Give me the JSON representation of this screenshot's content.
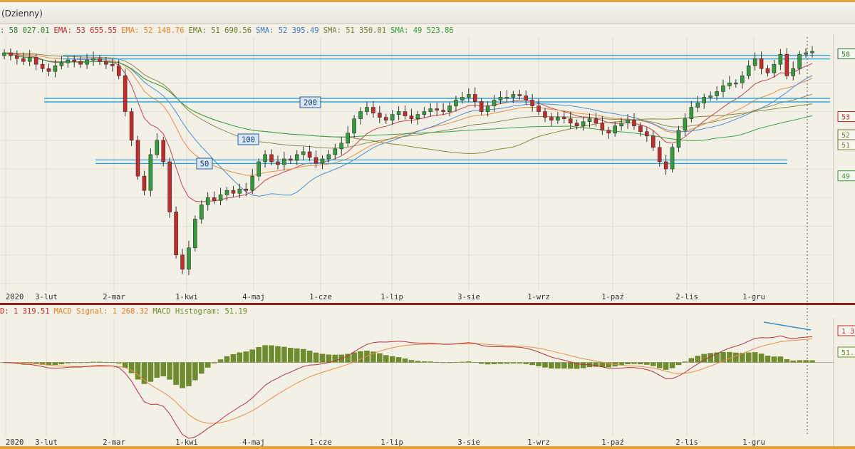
{
  "window": {
    "title": "(Dzienny)"
  },
  "price_legend": [
    {
      "text": ": 58 027.01",
      "color": "#2e7d32"
    },
    {
      "text": "EMA: 53 655.55",
      "color": "#c62828"
    },
    {
      "text": "EMA: 52 148.76",
      "color": "#e67e22"
    },
    {
      "text": "EMA: 51 690.56",
      "color": "#6b7d2e"
    },
    {
      "text": "SMA: 52 395.49",
      "color": "#3a78c9"
    },
    {
      "text": "SMA: 51 350.01",
      "color": "#7a7a3a"
    },
    {
      "text": "SMA: 49 523.86",
      "color": "#2e9d3a"
    }
  ],
  "macd_legend": [
    {
      "text": "D: 1 319.51",
      "color": "#c62828"
    },
    {
      "text": "MACD Signal: 1 268.32",
      "color": "#e67e22"
    },
    {
      "text": "MACD Histogram: 51.19",
      "color": "#6b8e23"
    }
  ],
  "chart_data": [
    {
      "type": "candlestick",
      "x_labels": [
        "2020",
        "3-lut",
        "2-mar",
        "1-kwi",
        "4-maj",
        "1-cze",
        "1-lip",
        "3-sie",
        "1-wrz",
        "1-paź",
        "2-lis",
        "1-gru"
      ],
      "ylim": [
        41500,
        59200
      ],
      "closes": [
        58100,
        57900,
        57700,
        57500,
        57800,
        57300,
        57000,
        56800,
        57200,
        57400,
        57600,
        57500,
        57300,
        57600,
        57700,
        57500,
        57300,
        57200,
        56500,
        54000,
        52000,
        49500,
        48500,
        51000,
        52000,
        50500,
        47000,
        44000,
        43000,
        44500,
        46500,
        47500,
        48000,
        47800,
        48200,
        48500,
        48300,
        48600,
        48500,
        49500,
        50500,
        51000,
        50500,
        50300,
        50700,
        50600,
        51000,
        51200,
        50800,
        50400,
        50700,
        51000,
        51400,
        51800,
        52500,
        53500,
        54000,
        54300,
        53900,
        53600,
        53400,
        53800,
        54000,
        53700,
        53500,
        53800,
        54000,
        54200,
        54100,
        54000,
        54400,
        54800,
        55000,
        55200,
        54700,
        54000,
        54400,
        54800,
        55000,
        55000,
        55200,
        55100,
        54800,
        54400,
        54000,
        53600,
        53400,
        53600,
        53500,
        53200,
        53000,
        53300,
        53500,
        53200,
        52700,
        52500,
        53000,
        53200,
        53400,
        53000,
        52600,
        52300,
        51500,
        50500,
        50000,
        51500,
        52700,
        53500,
        54300,
        54600,
        55000,
        55100,
        55400,
        55800,
        56000,
        56000,
        56500,
        57200,
        57700,
        57000,
        56700,
        57300,
        58000,
        56500,
        57000,
        58000,
        58100,
        58200
      ],
      "support_resistance_levels": [
        57800,
        54800,
        50500
      ],
      "ma_labels": [
        {
          "text": "200",
          "color": "#5a8bc4"
        },
        {
          "text": "100",
          "color": "#5a8bc4"
        },
        {
          "text": "50",
          "color": "#5a8bc4"
        }
      ],
      "right_axis_labels": [
        {
          "text": "58",
          "value": 58027,
          "color": "#2e7d32"
        },
        {
          "text": "53",
          "value": 53655,
          "color": "#c62828"
        },
        {
          "text": "52",
          "value": 52390,
          "color": "#6b7d2e"
        },
        {
          "text": "51",
          "value": 51690,
          "color": "#7a7a3a"
        },
        {
          "text": "49",
          "value": 49520,
          "color": "#2e9d3a"
        }
      ]
    },
    {
      "type": "macd",
      "ylim": [
        -3200,
        1900
      ],
      "macd_label": {
        "text": "1 3",
        "value": 1319,
        "color": "#c62828"
      },
      "hist_label": {
        "text": "51.",
        "value": 51,
        "color": "#6b8e23"
      }
    }
  ]
}
